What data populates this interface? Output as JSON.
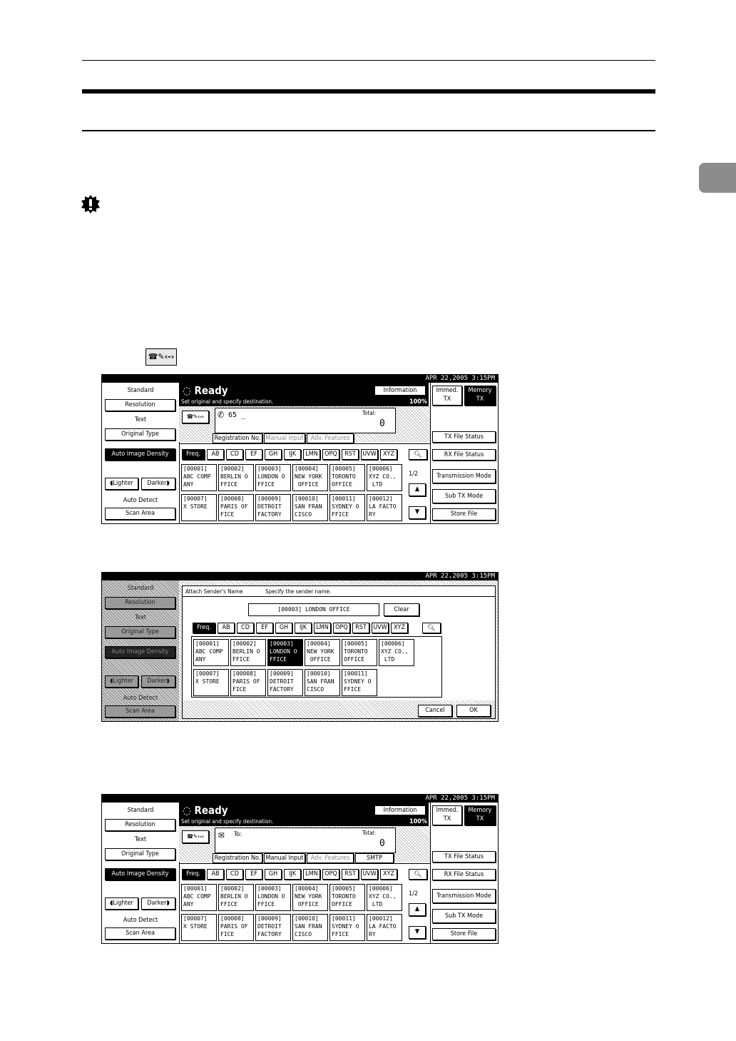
{
  "screen1": {
    "datetime": "APR  22,2005  3:15PM",
    "left": {
      "standard": "Standard",
      "resolution": "Resolution",
      "text": "Text",
      "original_type": "Original Type",
      "auto_density": "Auto Image Density",
      "lighter": "Lighter",
      "darker": "Darker",
      "auto_detect": "Auto Detect",
      "scan_area": "Scan Area"
    },
    "ready": "Ready",
    "instruction": "Set original and specify destination.",
    "information": "Information",
    "percent": "100%",
    "dest_input": "65 _",
    "total_label": "Total:",
    "total_value": "0",
    "tabs": [
      "Registration No.",
      "Manual Input",
      "Adv. Features"
    ],
    "groups": [
      "Freq.",
      "AB",
      "CD",
      "EF",
      "GH",
      "IJK",
      "LMN",
      "OPQ",
      "RST",
      "UVW",
      "XYZ"
    ],
    "destinations": [
      {
        "id": "[00001]",
        "l1": "ABC COMP",
        "l2": "ANY"
      },
      {
        "id": "[00002]",
        "l1": "BERLIN O",
        "l2": "FFICE"
      },
      {
        "id": "[00003]",
        "l1": "LONDON O",
        "l2": "FFICE"
      },
      {
        "id": "[00004]",
        "l1": "NEW YORK",
        "l2": " OFFICE"
      },
      {
        "id": "[00005]",
        "l1": "TORONTO",
        "l2": "OFFICE"
      },
      {
        "id": "[00006]",
        "l1": "XYZ CO.,",
        "l2": " LTD"
      },
      {
        "id": "[00007]",
        "l1": "X STORE",
        "l2": ""
      },
      {
        "id": "[00008]",
        "l1": "PARIS OF",
        "l2": "FICE"
      },
      {
        "id": "[00009]",
        "l1": "DETROIT",
        "l2": "FACTORY"
      },
      {
        "id": "[00010]",
        "l1": "SAN FRAN",
        "l2": "CISCO"
      },
      {
        "id": "[00011]",
        "l1": "SYDNEY O",
        "l2": "FFICE"
      },
      {
        "id": "[00012]",
        "l1": "LA FACTO",
        "l2": "RY"
      }
    ],
    "page": "1/2",
    "right": {
      "immed": "Immed.\nTX",
      "memory": "Memory\nTX",
      "tx_status": "TX File Status",
      "rx_status": "RX File Status",
      "trans_mode": "Transmission Mode",
      "sub_tx": "Sub TX Mode",
      "store_file": "Store File"
    }
  },
  "screen2": {
    "datetime": "APR  22,2005  3:15PM",
    "dialog_title": "Attach Sender's Name",
    "dialog_hint": "Specify the sender name.",
    "selected_name": "[00003] LONDON OFFICE",
    "clear": "Clear",
    "groups": [
      "Freq.",
      "AB",
      "CD",
      "EF",
      "GH",
      "IJK",
      "LMN",
      "OPQ",
      "RST",
      "UVW",
      "XYZ"
    ],
    "destinations": [
      {
        "id": "[00001]",
        "l1": "ABC COMP",
        "l2": "ANY"
      },
      {
        "id": "[00002]",
        "l1": "BERLIN O",
        "l2": "FFICE"
      },
      {
        "id": "[00003]",
        "l1": "LONDON O",
        "l2": "FFICE"
      },
      {
        "id": "[00004]",
        "l1": "NEW YORK",
        "l2": " OFFICE"
      },
      {
        "id": "[00005]",
        "l1": "TORONTO",
        "l2": "OFFICE"
      },
      {
        "id": "[00006]",
        "l1": "XYZ CO.,",
        "l2": " LTD"
      },
      {
        "id": "[00007]",
        "l1": "X STORE",
        "l2": ""
      },
      {
        "id": "[00008]",
        "l1": "PARIS OF",
        "l2": "FICE"
      },
      {
        "id": "[00009]",
        "l1": "DETROIT",
        "l2": "FACTORY"
      },
      {
        "id": "[00010]",
        "l1": "SAN FRAN",
        "l2": "CISCO"
      },
      {
        "id": "[00011]",
        "l1": "SYDNEY O",
        "l2": "FFICE"
      }
    ],
    "cancel": "Cancel",
    "ok": "OK"
  },
  "screen3": {
    "to_label": "To:",
    "tabs": [
      "Registration No.",
      "Manual Input",
      "Adv. Features",
      "SMTP"
    ]
  },
  "icons": {
    "important": "important-icon",
    "dest_key": "☎✎‹-›"
  }
}
